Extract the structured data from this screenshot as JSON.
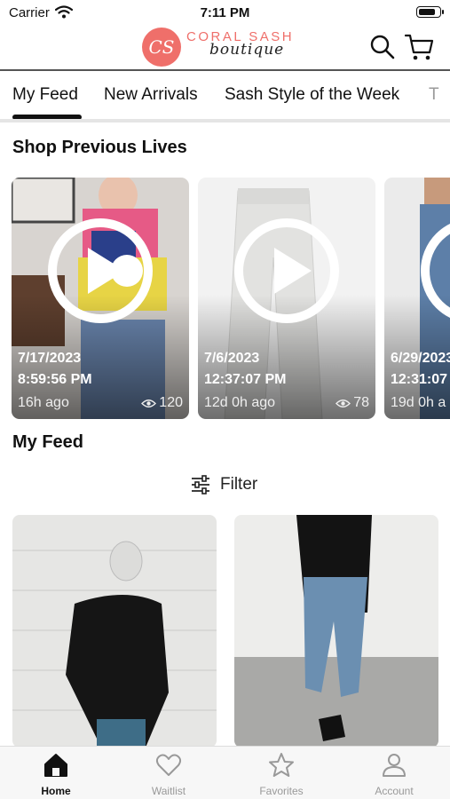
{
  "status_bar": {
    "carrier": "Carrier",
    "time": "7:11 PM",
    "battery_level": 0.85
  },
  "header": {
    "logo_monogram": "CS",
    "logo_top": "CORAL SASH",
    "logo_script": "boutique",
    "icons": [
      "search-icon",
      "cart-icon"
    ],
    "brand_color": "#ef6f6a"
  },
  "tabs": [
    {
      "label": "My Feed",
      "active": true
    },
    {
      "label": "New Arrivals"
    },
    {
      "label": "Sash Style of the Week"
    },
    {
      "label": "T"
    }
  ],
  "lives": {
    "title": "Shop Previous Lives",
    "items": [
      {
        "date": "7/17/2023",
        "time": "8:59:56 PM",
        "ago": "16h ago",
        "views": "120"
      },
      {
        "date": "7/6/2023",
        "time": "12:37:07 PM",
        "ago": "12d 0h ago",
        "views": "78"
      },
      {
        "date": "6/29/2023",
        "time": "12:31:07",
        "ago": "19d 0h a",
        "views": ""
      }
    ]
  },
  "feed": {
    "title": "My Feed",
    "filter_label": "Filter"
  },
  "bottom_nav": [
    {
      "label": "Home",
      "icon": "home-icon",
      "active": true
    },
    {
      "label": "Waitlist",
      "icon": "heart-icon"
    },
    {
      "label": "Favorites",
      "icon": "star-icon"
    },
    {
      "label": "Account",
      "icon": "account-icon"
    }
  ]
}
